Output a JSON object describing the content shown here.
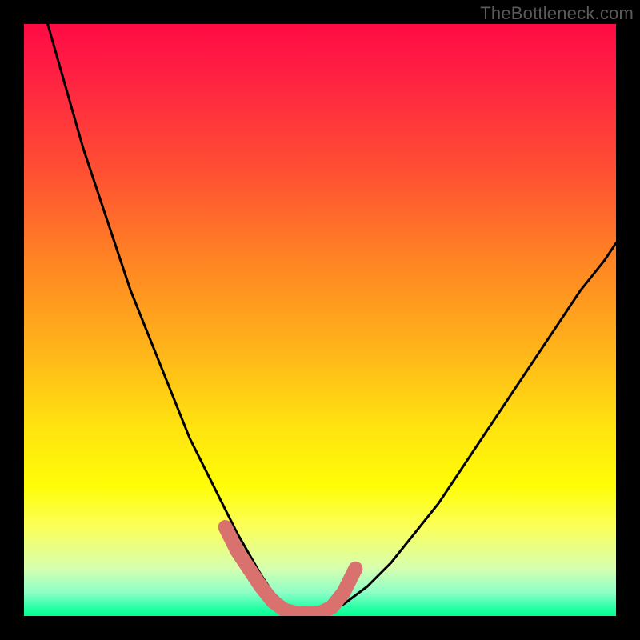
{
  "watermark": "TheBottleneck.com",
  "chart_data": {
    "type": "line",
    "title": "",
    "xlabel": "",
    "ylabel": "",
    "xlim": [
      0,
      100
    ],
    "ylim": [
      0,
      100
    ],
    "series": [
      {
        "name": "curve",
        "x": [
          4,
          6,
          8,
          10,
          12,
          14,
          16,
          18,
          20,
          22,
          24,
          26,
          28,
          30,
          32,
          34,
          36,
          38,
          40,
          42,
          44,
          46,
          50,
          54,
          58,
          62,
          66,
          70,
          74,
          78,
          82,
          86,
          90,
          94,
          98,
          100
        ],
        "y": [
          100,
          93,
          86,
          79,
          73,
          67,
          61,
          55,
          50,
          45,
          40,
          35,
          30,
          26,
          22,
          18,
          14,
          10.5,
          7,
          4,
          2,
          0.5,
          0.5,
          2,
          5,
          9,
          14,
          19,
          25,
          31,
          37,
          43,
          49,
          55,
          60,
          63
        ]
      },
      {
        "name": "marker-cluster",
        "x": [
          34,
          36,
          38,
          40,
          42,
          44,
          46,
          48,
          50,
          52,
          54,
          56
        ],
        "y": [
          15,
          11,
          8,
          5,
          2.5,
          1,
          0.5,
          0.5,
          0.5,
          1.5,
          4,
          8
        ]
      }
    ],
    "colors": {
      "curve": "#000000",
      "markers": "#d9716e",
      "gradient_top": "#ff0b44",
      "gradient_mid": "#ffe30f",
      "gradient_bottom": "#00ff90"
    }
  }
}
